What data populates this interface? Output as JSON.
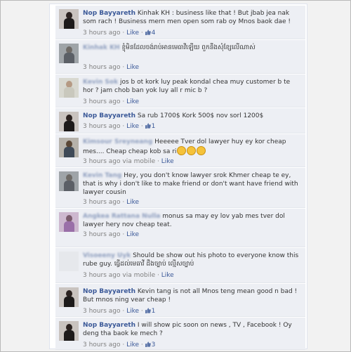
{
  "colors": {
    "link": "#3b5998",
    "meta": "#808080",
    "comment_bg": "#edeff4",
    "emoji": "#f5c23a"
  },
  "comments": [
    {
      "author": "Nop Bayyareth",
      "author_blurred": false,
      "text": "Kinhak KH : business like that ! But jbab jea nak som rach ! Business mern men open som rab oy Mnos baok dae !",
      "time": "3 hours ago",
      "via": "",
      "like_label": "Like",
      "likes": "4",
      "avatar": "photo-dark"
    },
    {
      "author": "Kinhak KH",
      "author_blurred": true,
      "text": "ខ្ញុំមិនដែលចង់រាប់អានមេធាវីឡើយ ពួកនឹងសុំខ្សែលើណាស់",
      "time": "3 hours ago",
      "via": "",
      "like_label": "Like",
      "likes": "",
      "avatar": "photo-grey"
    },
    {
      "author": "Kevin Sok",
      "author_blurred": true,
      "text": "jos b ot kork luy peak kondal chea muy customer b te hor ? jam chob ban yok luy all r mic b ?",
      "time": "3 hours ago",
      "via": "",
      "like_label": "Like",
      "likes": "",
      "avatar": "photo-light"
    },
    {
      "author": "Nop Bayyareth",
      "author_blurred": false,
      "text": "Sa rub 1700$ Kork 500$ nov sorl 1200$",
      "time": "3 hours ago",
      "via": "",
      "like_label": "Like",
      "likes": "1",
      "avatar": "photo-dark"
    },
    {
      "author": "Kimsour Sreyneang",
      "author_blurred": true,
      "text": "Heeeee Tver dol lawyer huy ey kor cheap mes.... Cheap cheap kob sa ri",
      "time": "3 hours ago",
      "via": "via mobile",
      "like_label": "Like",
      "likes": "",
      "avatar": "photo-man",
      "emoji_count": 3
    },
    {
      "author": "Kevin Tang",
      "author_blurred": true,
      "text": "Hey, you don't know lawyer srok Khmer cheap te ey, that is why i don't like to make friend or don't want have friend with lawyer cousin",
      "time": "3 hours ago",
      "via": "",
      "like_label": "Like",
      "likes": "",
      "avatar": "photo-grey"
    },
    {
      "author": "Angkea Rattana Nulla",
      "author_blurred": true,
      "text": "monus sa may ey lov yab mes tver dol lawyer hery nov cheap teat.",
      "time": "3 hours ago",
      "via": "",
      "like_label": "Like",
      "likes": "",
      "avatar": "photo-purple"
    },
    {
      "author": "Visoeeny Uyk",
      "author_blurred": true,
      "text": "Should be show out his photo to everyone know this rube guy. ធ្វើដល់មេធាវី ដឹងច្បាប់ ល្មើសច្បាប់",
      "time": "3 hours ago",
      "via": "via mobile",
      "like_label": "Like",
      "likes": "",
      "avatar": "photo-blank"
    },
    {
      "author": "Nop Bayyareth",
      "author_blurred": false,
      "text": "Kevin tang is not all Mnos teng mean good n bad ! But mnos ning vear cheap !",
      "time": "3 hours ago",
      "via": "",
      "like_label": "Like",
      "likes": "1",
      "avatar": "photo-dark"
    },
    {
      "author": "Nop Bayyareth",
      "author_blurred": false,
      "text": "I will show pic soon on news , TV , Facebook ! Oy deng tha baok ke mech ?",
      "time": "3 hours ago",
      "via": "",
      "like_label": "Like",
      "likes": "3",
      "avatar": "photo-dark"
    }
  ]
}
